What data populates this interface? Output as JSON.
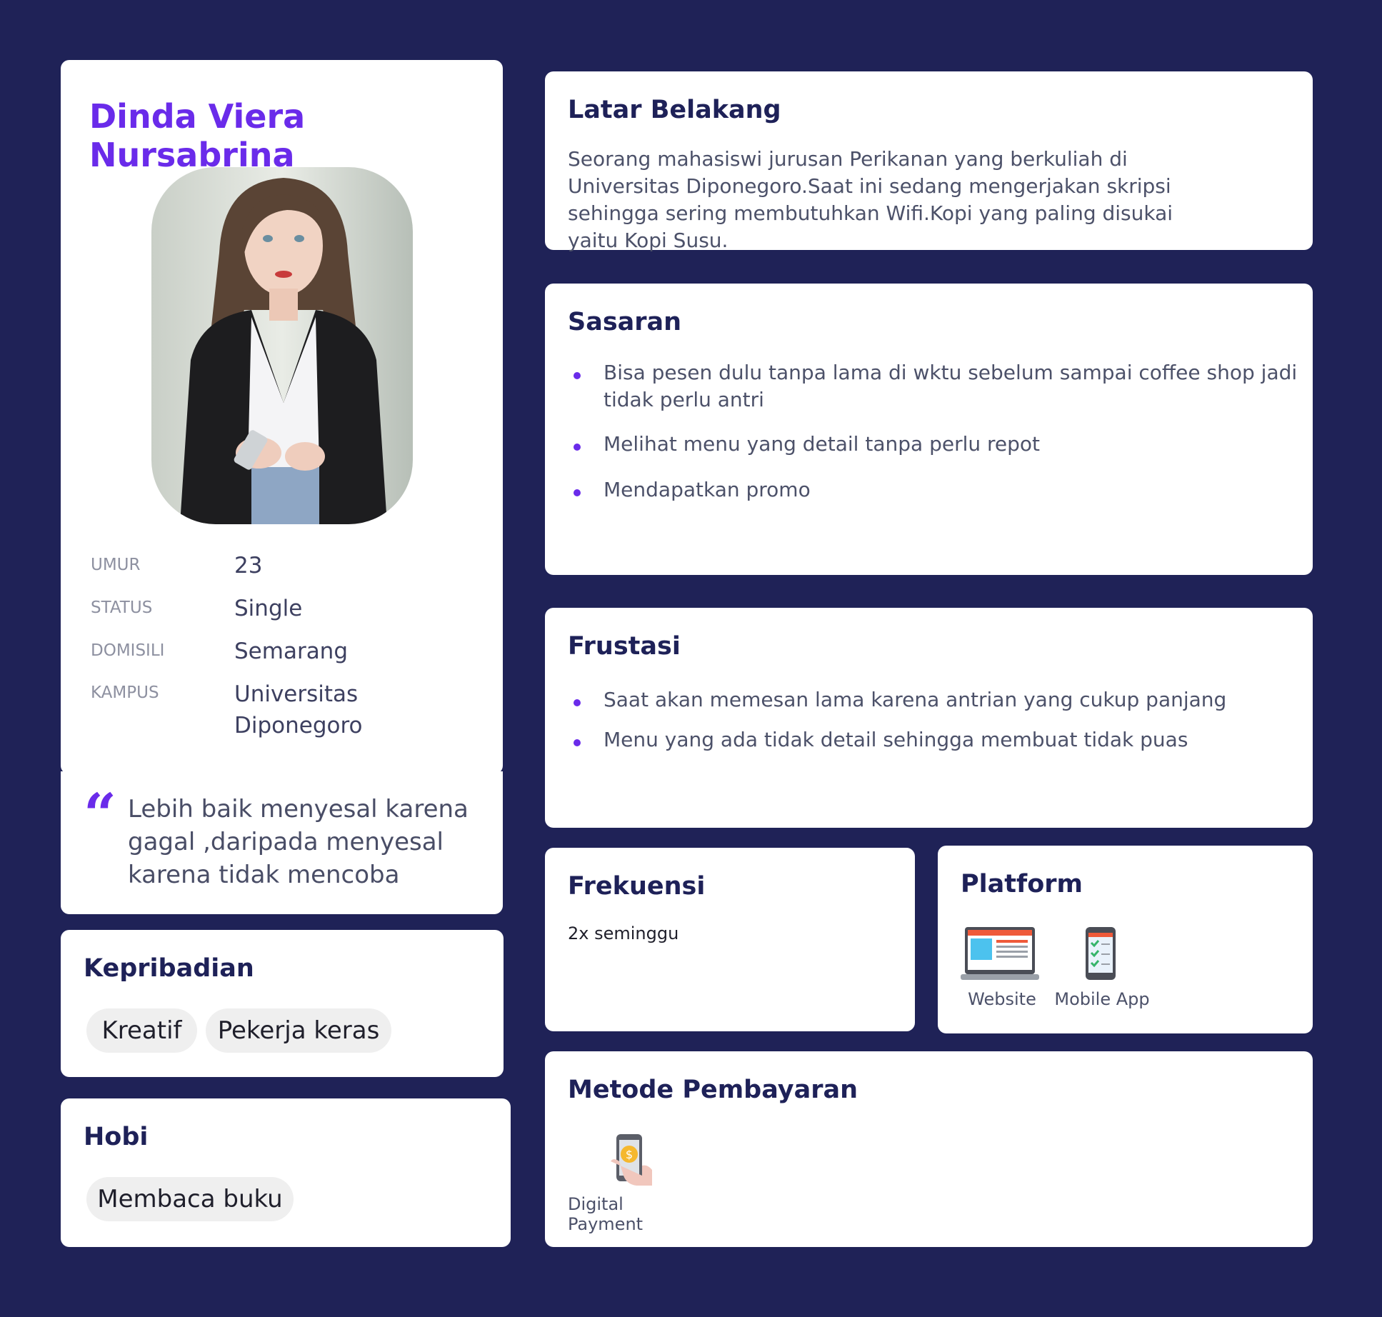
{
  "profile": {
    "name": "Dinda Viera Nursabrina",
    "photo_alt": "Foto persona",
    "info": [
      {
        "label": "UMUR",
        "value": "23"
      },
      {
        "label": "STATUS",
        "value": "Single"
      },
      {
        "label": "DOMISILI",
        "value": "Semarang"
      },
      {
        "label": "KAMPUS",
        "value": "Universitas Diponegoro"
      }
    ]
  },
  "quote": {
    "mark": "“",
    "text": "Lebih baik menyesal karena gagal ,daripada menyesal karena tidak mencoba"
  },
  "kepribadian": {
    "title": "Kepribadian",
    "tags": [
      "Kreatif",
      "Pekerja keras"
    ]
  },
  "hobi": {
    "title": "Hobi",
    "tags": [
      "Membaca buku"
    ]
  },
  "latar": {
    "title": "Latar Belakang",
    "text": "Seorang mahasiswi jurusan Perikanan yang berkuliah di Universitas Diponegoro.Saat ini sedang mengerjakan skripsi sehingga sering membutuhkan Wifi.Kopi yang paling disukai yaitu Kopi Susu."
  },
  "sasaran": {
    "title": "Sasaran",
    "items": [
      "Bisa pesen dulu tanpa lama di wktu sebelum sampai coffee shop jadi tidak perlu antri",
      "Melihat menu yang detail tanpa perlu repot",
      "Mendapatkan promo"
    ]
  },
  "frustasi": {
    "title": "Frustasi",
    "items": [
      "Saat akan memesan lama karena antrian yang cukup panjang",
      "Menu yang ada tidak detail sehingga membuat tidak puas"
    ]
  },
  "frekuensi": {
    "title": "Frekuensi",
    "text": "2x seminggu"
  },
  "platform": {
    "title": "Platform",
    "items": [
      {
        "label": "Website",
        "icon": "laptop-website-icon"
      },
      {
        "label": "Mobile App",
        "icon": "mobile-app-icon"
      }
    ]
  },
  "pembayaran": {
    "title": "Metode Pembayaran",
    "items": [
      {
        "label": "Digital Payment",
        "icon": "digital-payment-icon"
      }
    ]
  },
  "colors": {
    "background": "#1f2257",
    "accent": "#6a2bea",
    "heading": "#1e2158"
  }
}
